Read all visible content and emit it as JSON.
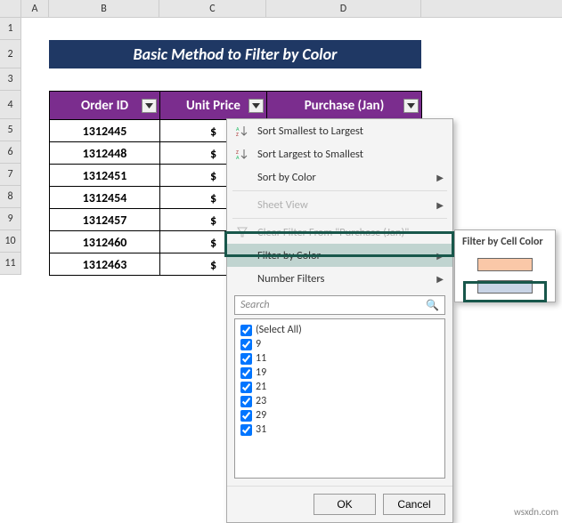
{
  "columns": {
    "a": "A",
    "b": "B",
    "c": "C",
    "d": "D"
  },
  "rows": [
    "1",
    "2",
    "3",
    "4",
    "5",
    "6",
    "7",
    "8",
    "9",
    "10",
    "11"
  ],
  "title": "Basic Method to Filter by Color",
  "headers": {
    "order": "Order ID",
    "price": "Unit Price",
    "purchase": "Purchase (Jan)"
  },
  "data_rows": [
    {
      "order": "1312445",
      "price": "$"
    },
    {
      "order": "1312448",
      "price": "$"
    },
    {
      "order": "1312451",
      "price": "$"
    },
    {
      "order": "1312454",
      "price": "$"
    },
    {
      "order": "1312457",
      "price": "$"
    },
    {
      "order": "1312460",
      "price": "$"
    },
    {
      "order": "1312463",
      "price": "$"
    }
  ],
  "menu": {
    "sort_asc": "Sort Smallest to Largest",
    "sort_desc": "Sort Largest to Smallest",
    "sort_color": "Sort by Color",
    "sheet_view": "Sheet View",
    "clear_filter": "Clear Filter From \"Purchase (Jan)\"",
    "filter_color": "Filter by Color",
    "number_filters": "Number Filters",
    "search_placeholder": "Search",
    "select_all": "(Select All)",
    "values": [
      "9",
      "11",
      "19",
      "21",
      "23",
      "29",
      "31"
    ],
    "ok": "OK",
    "cancel": "Cancel"
  },
  "submenu": {
    "title": "Filter by Cell Color"
  },
  "watermark": "wsxdn.com"
}
